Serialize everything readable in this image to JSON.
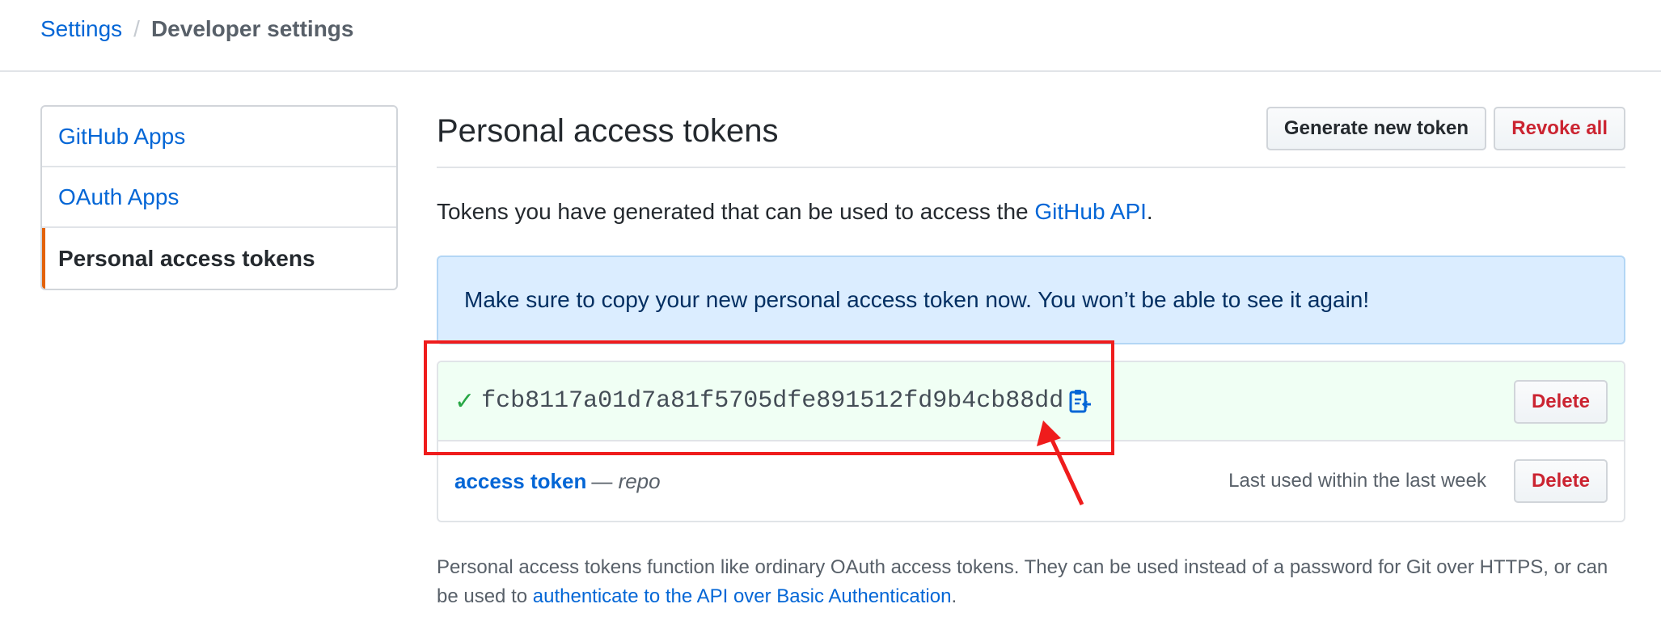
{
  "header": {
    "breadcrumb_root": "Settings",
    "breadcrumb_separator": "/",
    "breadcrumb_current": "Developer settings"
  },
  "sidebar": {
    "items": [
      {
        "label": "GitHub Apps",
        "selected": false
      },
      {
        "label": "OAuth Apps",
        "selected": false
      },
      {
        "label": "Personal access tokens",
        "selected": true
      }
    ]
  },
  "main": {
    "title": "Personal access tokens",
    "generate_button": "Generate new token",
    "revoke_button": "Revoke all",
    "intro_prefix": "Tokens you have generated that can be used to access the ",
    "intro_link": "GitHub API",
    "intro_suffix": ".",
    "flash_message": "Make sure to copy your new personal access token now. You won’t be able to see it again!",
    "new_token": {
      "value": "fcb8117a01d7a81f5705dfe891512fd9b4cb88dd",
      "delete_label": "Delete"
    },
    "existing_token": {
      "name": "access token",
      "dash": "—",
      "scope": "repo",
      "last_used": "Last used within the last week",
      "delete_label": "Delete"
    },
    "footnote_text": "Personal access tokens function like ordinary OAuth access tokens. They can be used instead of a password for Git over HTTPS, or can be used to ",
    "footnote_link": "authenticate to the API over Basic Authentication",
    "footnote_suffix": "."
  },
  "colors": {
    "link": "#0366d6",
    "danger": "#cb2431",
    "success": "#28a745",
    "flash_bg": "#dbedff",
    "new_token_bg": "#f0fff4",
    "annotation": "#ef1c1c",
    "selected_accent": "#e36209"
  },
  "icons": {
    "check": "check-icon",
    "copy": "clippy-icon"
  }
}
